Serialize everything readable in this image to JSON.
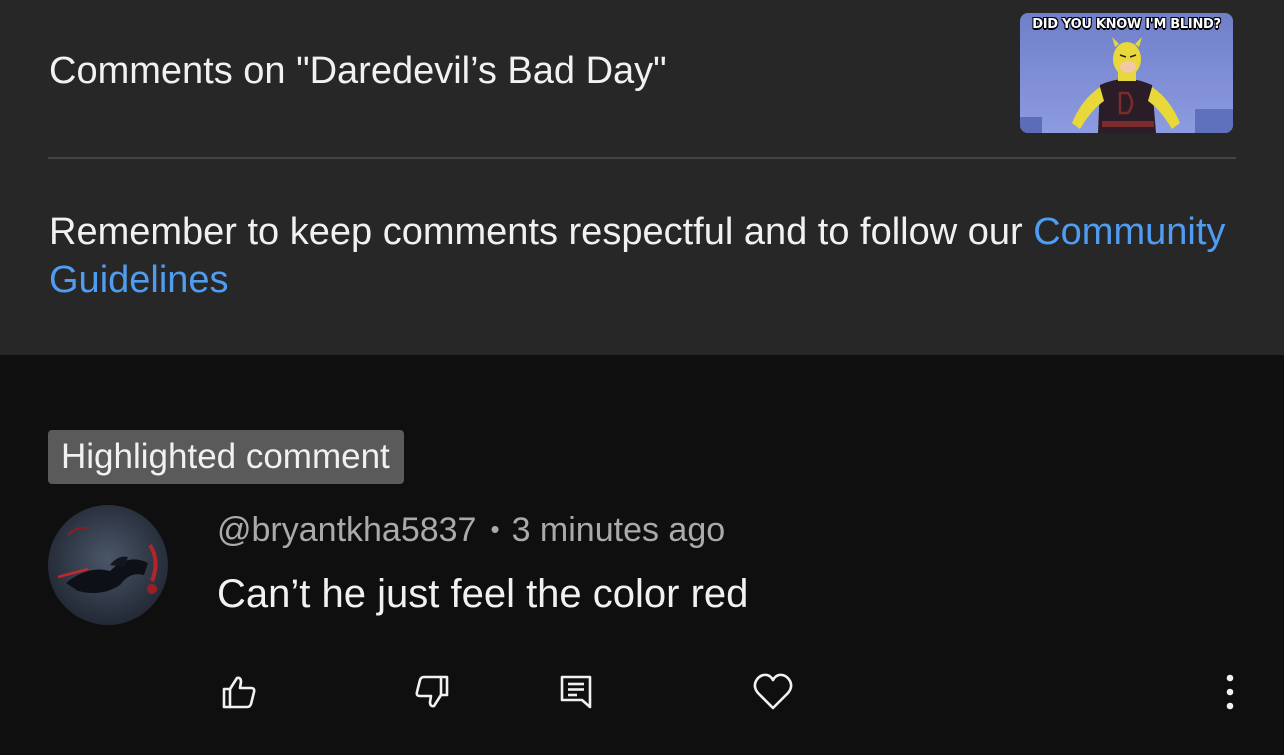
{
  "header": {
    "title": "Comments on \"Daredevil’s Bad Day\"",
    "thumbnail_caption": "DID YOU KNOW I'M BLIND?"
  },
  "guidelines": {
    "text": "Remember to keep comments respectful and to follow our ",
    "link_label": "Community Guidelines"
  },
  "comment": {
    "badge": "Highlighted comment",
    "author": "@bryantkha5837",
    "separator": "•",
    "time": "3 minutes ago",
    "text": "Can’t he just feel the color red"
  },
  "actions": {
    "icons": [
      "thumbs-up-icon",
      "thumbs-down-icon",
      "reply-icon",
      "heart-icon",
      "more-vertical-icon"
    ]
  },
  "colors": {
    "panel_bg": "#272727",
    "page_bg": "#0f0f0f",
    "link": "#4f9cf0",
    "badge_bg": "#5a5a5a"
  }
}
